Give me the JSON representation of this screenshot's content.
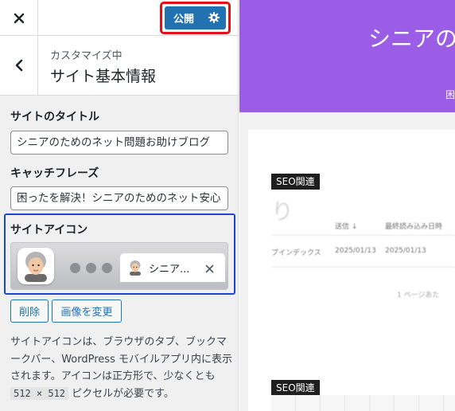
{
  "toolbar": {
    "close_icon": "close-icon",
    "publish_label": "公開",
    "publish_settings_icon": "gear-icon"
  },
  "section": {
    "back_icon": "chevron-left-icon",
    "meta": "カスタマイズ中",
    "title": "サイト基本情報"
  },
  "fields": {
    "site_title_label": "サイトのタイトル",
    "site_title_value": "シニアのためのネット問題お助けブログ",
    "tagline_label": "キャッチフレーズ",
    "tagline_value": "困ったを解決！シニアのためのネット安心",
    "site_icon_label": "サイトアイコン",
    "site_icon_tab_title": "シニア...",
    "tab_close_icon": "close-icon",
    "remove_label": "削除",
    "change_image_label": "画像を変更"
  },
  "description": {
    "text_before": "サイトアイコンは、ブラウザのタブ、ブックマークバー、WordPress モバイルアプリ内に表示されます。アイコンは正方形で、少なくとも ",
    "size_code": "512 × 512",
    "text_after": " ピクセルが必要です。"
  },
  "preview": {
    "hero_title": "シニアの",
    "hero_sub": "困",
    "card_tag_1": "SEO関連",
    "card_tag_2": "SEO関連",
    "blur_heading": "り",
    "col_sent": "送信 ↓",
    "col_last_read": "最終読み込み日時",
    "row_name": "プインデックス",
    "row_date_1": "2025/01/13",
    "row_date_2": "2025/01/13",
    "pager": "1 ページあた"
  },
  "colors": {
    "accent": "#2271b1",
    "hero_bg": "#9b5de5",
    "publish_highlight": "#e3101a",
    "icon_highlight": "#1d45d4"
  }
}
